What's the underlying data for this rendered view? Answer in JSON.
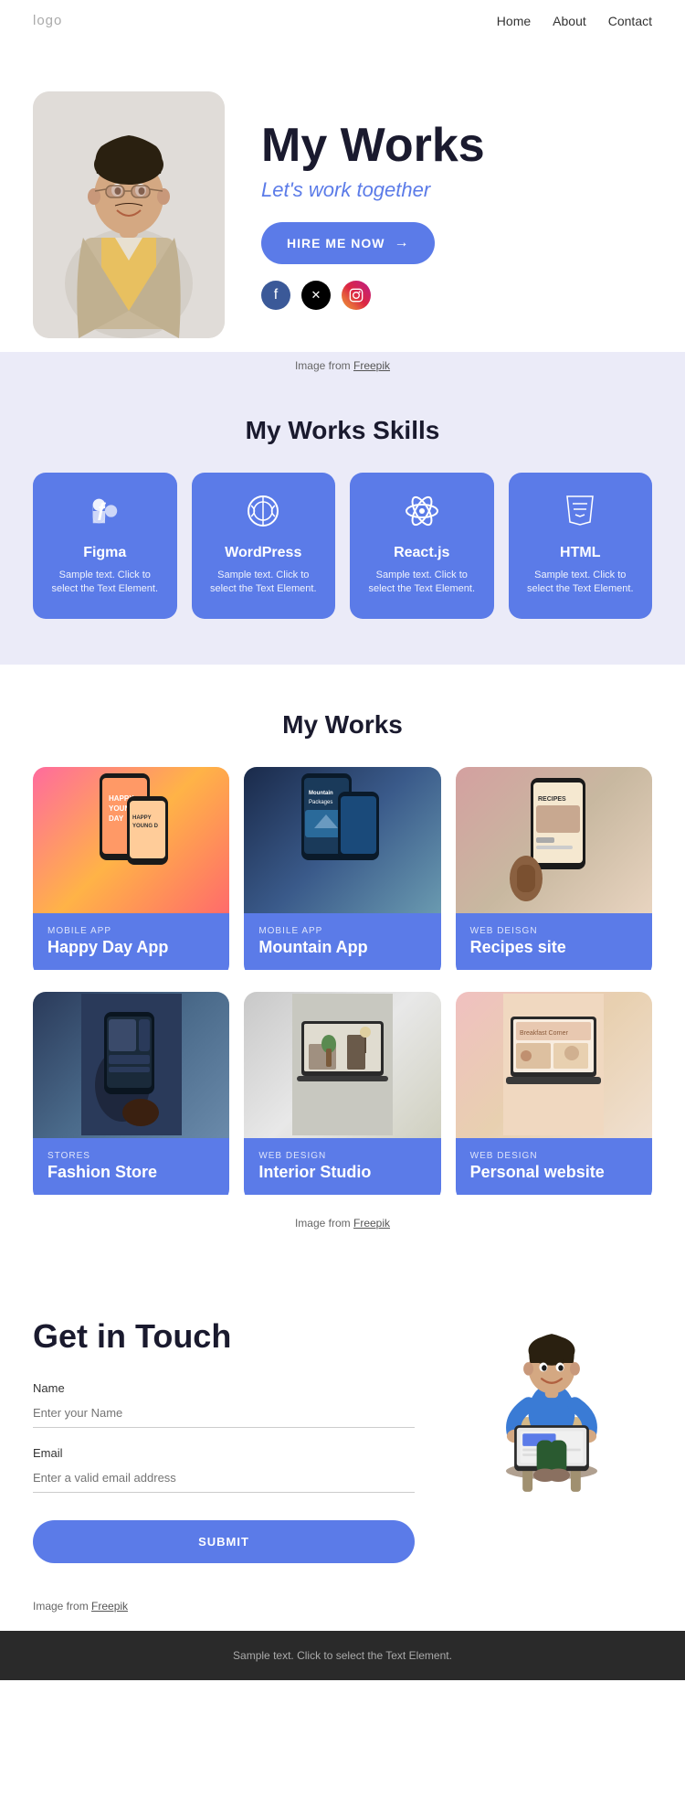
{
  "nav": {
    "logo": "logo",
    "links": [
      "Home",
      "About",
      "Contact"
    ]
  },
  "hero": {
    "title": "My Works",
    "subtitle": "Let's work together",
    "hire_btn": "HIRE ME NOW",
    "image_credit": "Image from ",
    "image_credit_link": "Freepik",
    "social": [
      "facebook",
      "twitter",
      "instagram"
    ]
  },
  "skills": {
    "section_title": "My Works Skills",
    "items": [
      {
        "icon": "figma",
        "name": "Figma",
        "desc": "Sample text. Click to select the Text Element."
      },
      {
        "icon": "wordpress",
        "name": "WordPress",
        "desc": "Sample text. Click to select the Text Element."
      },
      {
        "icon": "react",
        "name": "React.js",
        "desc": "Sample text. Click to select the Text Element."
      },
      {
        "icon": "html",
        "name": "HTML",
        "desc": "Sample text. Click to select the Text Element."
      }
    ]
  },
  "works": {
    "section_title": "My Works",
    "items": [
      {
        "category": "MOBILE APP",
        "title": "Happy Day App"
      },
      {
        "category": "MOBILE APP",
        "title": "Mountain App"
      },
      {
        "category": "WEB DEISGN",
        "title": "Recipes site"
      },
      {
        "category": "STORES",
        "title": "Fashion Store"
      },
      {
        "category": "WEB DESIGN",
        "title": "Interior Studio"
      },
      {
        "category": "WEB DESIGN",
        "title": "Personal website"
      }
    ],
    "image_credit": "Image from ",
    "image_credit_link": "Freepik"
  },
  "contact": {
    "title": "Get in Touch",
    "name_label": "Name",
    "name_placeholder": "Enter your Name",
    "email_label": "Email",
    "email_placeholder": "Enter a valid email address",
    "submit_btn": "SUBMIT",
    "image_credit": "Image from ",
    "image_credit_link": "Freepik"
  },
  "footer": {
    "text": "Sample text. Click to select the Text Element."
  }
}
